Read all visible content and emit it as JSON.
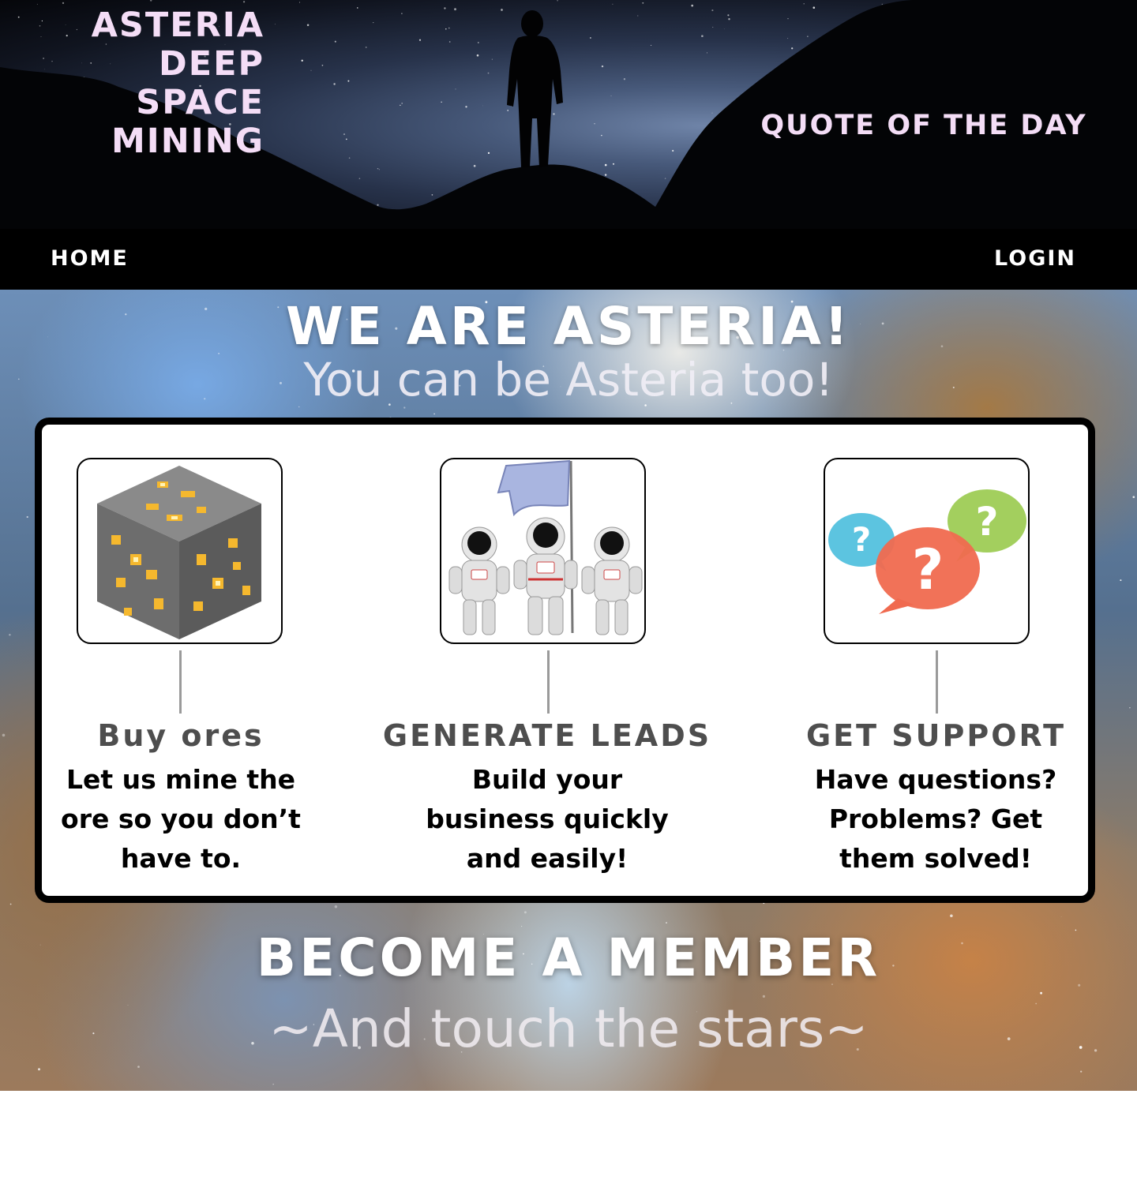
{
  "header": {
    "brand_lines": [
      "ASTERIA",
      "DEEP",
      "SPACE",
      "MINING"
    ],
    "quote_label": "QUOTE OF THE DAY"
  },
  "nav": {
    "home": "HOME",
    "login": "LOGIN"
  },
  "hero_section": {
    "title": "WE ARE ASTERIA!",
    "subtitle": "You can be Asteria too!"
  },
  "features": [
    {
      "icon": "gold-ore-block-icon",
      "title": "Buy ores",
      "description": "Let us mine the ore so you don’t have to."
    },
    {
      "icon": "astronauts-flag-icon",
      "title": "GENERATE LEADS",
      "description": "Build your business quickly and easily!"
    },
    {
      "icon": "question-bubbles-icon",
      "title": "GET SUPPORT",
      "description": "Have questions? Problems? Get them solved!"
    }
  ],
  "membership": {
    "title": "BECOME A MEMBER",
    "subtitle": "~And touch the stars~"
  },
  "colors": {
    "brand_text": "#f4ddf6",
    "nav_background": "#000000",
    "feature_title": "#4e4e4e"
  }
}
